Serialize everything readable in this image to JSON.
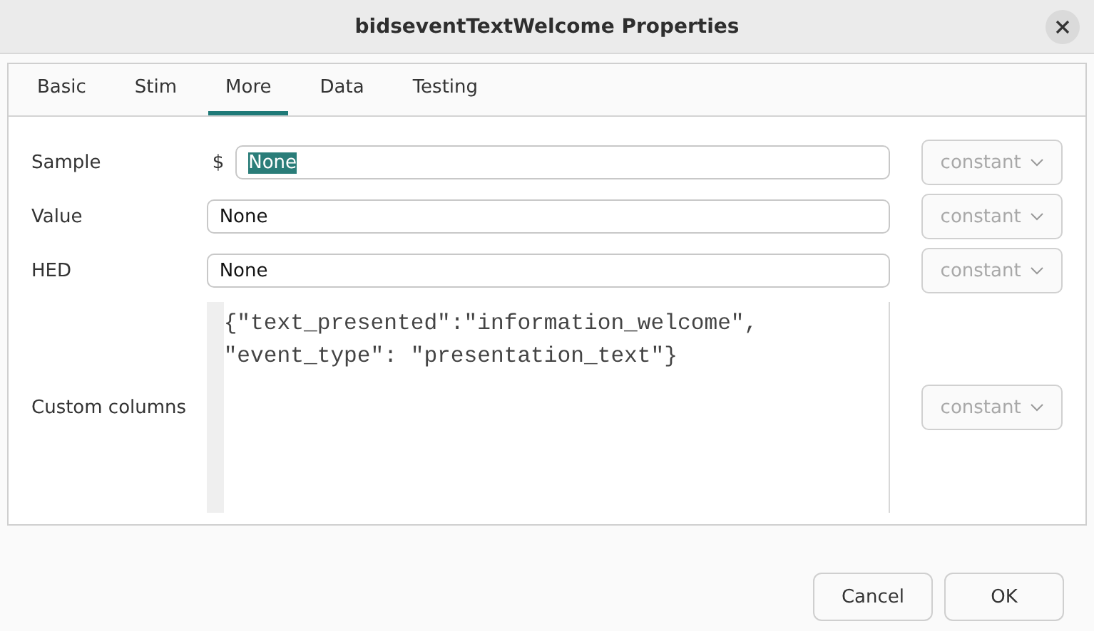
{
  "window": {
    "title": "bidseventTextWelcome Properties"
  },
  "tabs": [
    {
      "label": "Basic",
      "selected": false
    },
    {
      "label": "Stim",
      "selected": false
    },
    {
      "label": "More",
      "selected": true
    },
    {
      "label": "Data",
      "selected": false
    },
    {
      "label": "Testing",
      "selected": false
    }
  ],
  "fields": [
    {
      "kind": "line",
      "label": "Sample",
      "prefix": "$",
      "value": "None",
      "text_selected": true,
      "mode": {
        "value": "constant",
        "disabled": true
      }
    },
    {
      "kind": "line",
      "label": "Value",
      "value": "None",
      "text_selected": false,
      "mode": {
        "value": "constant",
        "disabled": true
      }
    },
    {
      "kind": "line",
      "label": "HED",
      "value": "None",
      "text_selected": false,
      "mode": {
        "value": "constant",
        "disabled": true
      }
    },
    {
      "kind": "code",
      "label": "Custom columns",
      "lines": [
        "{\"text_presented\":\"information_welcome\",",
        "\"event_type\": \"presentation_text\"}"
      ],
      "mode": {
        "value": "constant",
        "disabled": true
      }
    }
  ],
  "buttons": [
    "Cancel",
    "OK"
  ]
}
